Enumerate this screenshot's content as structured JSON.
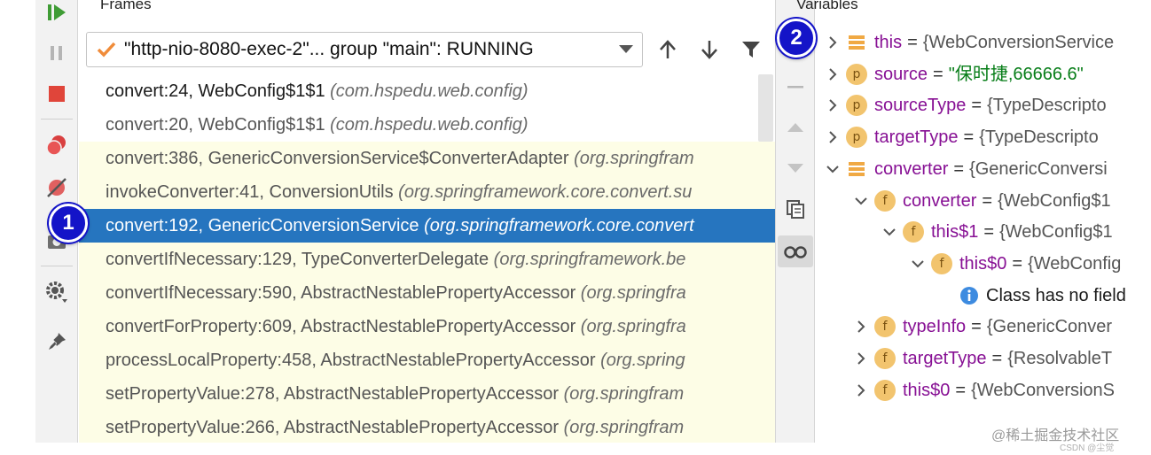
{
  "frames": {
    "title": "Frames",
    "thread": "\"http-nio-8080-exec-2\"... group \"main\": RUNNING",
    "rows": [
      {
        "method": "convert:24, WebConfig$1$1",
        "pkg": "(com.hspedu.web.config)",
        "style": "normal"
      },
      {
        "method": "convert:20, WebConfig$1$1",
        "pkg": "(com.hspedu.web.config)",
        "style": "grey"
      },
      {
        "method": "convert:386, GenericConversionService$ConverterAdapter",
        "pkg": "(org.springfram",
        "style": "lib"
      },
      {
        "method": "invokeConverter:41, ConversionUtils",
        "pkg": "(org.springframework.core.convert.su",
        "style": "lib"
      },
      {
        "method": "convert:192, GenericConversionService",
        "pkg": "(org.springframework.core.convert",
        "style": "selected"
      },
      {
        "method": "convertIfNecessary:129, TypeConverterDelegate",
        "pkg": "(org.springframework.be",
        "style": "lib"
      },
      {
        "method": "convertIfNecessary:590, AbstractNestablePropertyAccessor",
        "pkg": "(org.springfra",
        "style": "lib"
      },
      {
        "method": "convertForProperty:609, AbstractNestablePropertyAccessor",
        "pkg": "(org.springfra",
        "style": "lib"
      },
      {
        "method": "processLocalProperty:458, AbstractNestablePropertyAccessor",
        "pkg": "(org.spring",
        "style": "lib"
      },
      {
        "method": "setPropertyValue:278, AbstractNestablePropertyAccessor",
        "pkg": "(org.springfram",
        "style": "lib"
      },
      {
        "method": "setPropertyValue:266, AbstractNestablePropertyAccessor",
        "pkg": "(org.springfram",
        "style": "lib"
      }
    ]
  },
  "variables": {
    "title": "Variables",
    "rows": [
      {
        "indent": 0,
        "expand": "collapsed",
        "badge": "list",
        "name": "this",
        "eq": "=",
        "value": "{WebConversionService",
        "str": false
      },
      {
        "indent": 0,
        "expand": "collapsed",
        "badge": "p",
        "name": "source",
        "eq": "=",
        "value": "\"保时捷,66666.6\"",
        "str": true
      },
      {
        "indent": 0,
        "expand": "collapsed",
        "badge": "p",
        "name": "sourceType",
        "eq": "=",
        "value": "{TypeDescripto",
        "str": false
      },
      {
        "indent": 0,
        "expand": "collapsed",
        "badge": "p",
        "name": "targetType",
        "eq": "=",
        "value": "{TypeDescripto",
        "str": false
      },
      {
        "indent": 0,
        "expand": "expanded",
        "badge": "list",
        "name": "converter",
        "eq": "=",
        "value": "{GenericConversi",
        "str": false
      },
      {
        "indent": 1,
        "expand": "expanded",
        "badge": "f",
        "name": "converter",
        "eq": "=",
        "value": "{WebConfig$1",
        "str": false
      },
      {
        "indent": 2,
        "expand": "expanded",
        "badge": "f",
        "name": "this$1",
        "eq": "=",
        "value": "{WebConfig$1",
        "str": false
      },
      {
        "indent": 3,
        "expand": "expanded",
        "badge": "f",
        "name": "this$0",
        "eq": "=",
        "value": "{WebConfig",
        "str": false
      },
      {
        "indent": 4,
        "expand": "none",
        "badge": "info",
        "name": "",
        "eq": "",
        "value": "Class has no field",
        "str": false
      },
      {
        "indent": 1,
        "expand": "collapsed",
        "badge": "f",
        "name": "typeInfo",
        "eq": "=",
        "value": "{GenericConver",
        "str": false
      },
      {
        "indent": 1,
        "expand": "collapsed",
        "badge": "f",
        "name": "targetType",
        "eq": "=",
        "value": "{ResolvableT",
        "str": false
      },
      {
        "indent": 1,
        "expand": "collapsed",
        "badge": "f",
        "name": "this$0",
        "eq": "=",
        "value": "{WebConversionS",
        "str": false
      }
    ]
  },
  "markers": {
    "one": "1",
    "two": "2"
  },
  "watermark": "@稀土掘金技术社区",
  "csdn": "CSDN @尘觉",
  "icons": {
    "resume": "resume-icon",
    "pause": "pause-icon",
    "stop": "stop-icon",
    "breakpoints": "view-breakpoints-icon",
    "mute": "mute-breakpoints-icon",
    "camera": "camera-icon",
    "settings": "gear-icon",
    "pin": "pin-icon",
    "up": "arrow-up-icon",
    "down": "arrow-down-icon",
    "filter": "filter-icon",
    "minus": "minus-icon",
    "copy": "copy-icon",
    "watch": "glasses-icon"
  },
  "colors": {
    "selection": "#2675bf",
    "libraryRow": "#fdfde6",
    "marker": "#1414c8",
    "badge": "#f2c46e",
    "string": "#067d17",
    "varName": "#871094"
  }
}
